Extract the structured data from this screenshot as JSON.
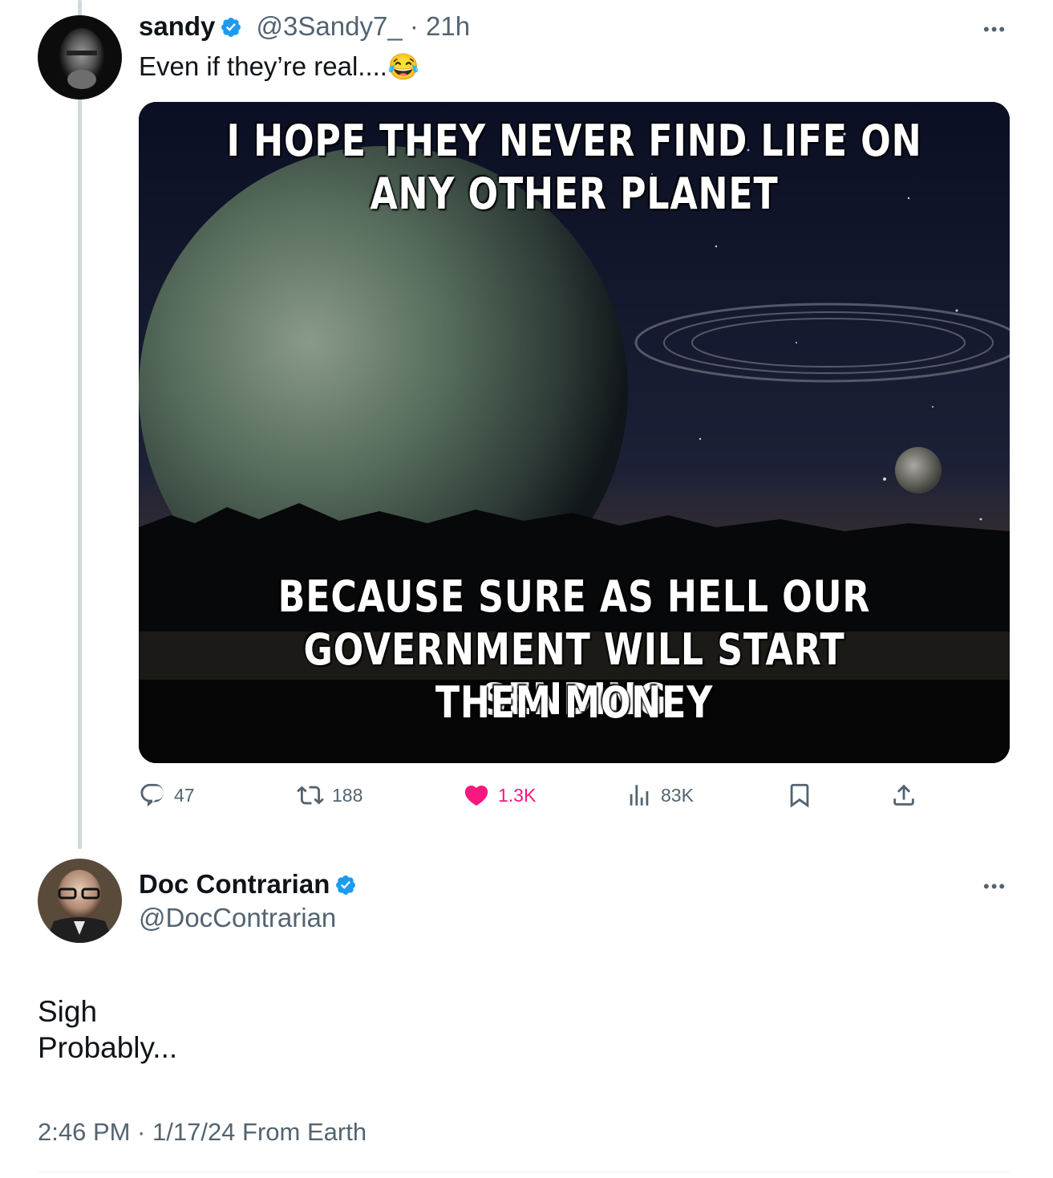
{
  "original_tweet": {
    "display_name": "sandy",
    "handle": "@3Sandy7_",
    "separator": "·",
    "time_ago": "21h",
    "text": "Even if they’re real....",
    "emoji": "😂",
    "more_icon": "ellipsis-icon",
    "image_text": {
      "top_line1": "I HOPE THEY NEVER FIND LIFE ON",
      "top_line2": "ANY OTHER PLANET",
      "bottom_line1": "BECAUSE SURE AS HELL OUR",
      "bottom_line2": "GOVERNMENT WILL START SENDING",
      "bottom_line3": "THEM MONEY"
    },
    "actions": {
      "replies": "47",
      "reposts": "188",
      "likes": "1.3K",
      "views": "83K"
    },
    "colors": {
      "like": "#f91880",
      "verified": "#1d9bf0",
      "muted": "#536471"
    }
  },
  "reply_tweet": {
    "display_name": "Doc Contrarian",
    "handle": "@DocContrarian",
    "text_line1": "Sigh",
    "text_line2": "Probably...",
    "meta": "2:46 PM · 1/17/24 From Earth"
  }
}
